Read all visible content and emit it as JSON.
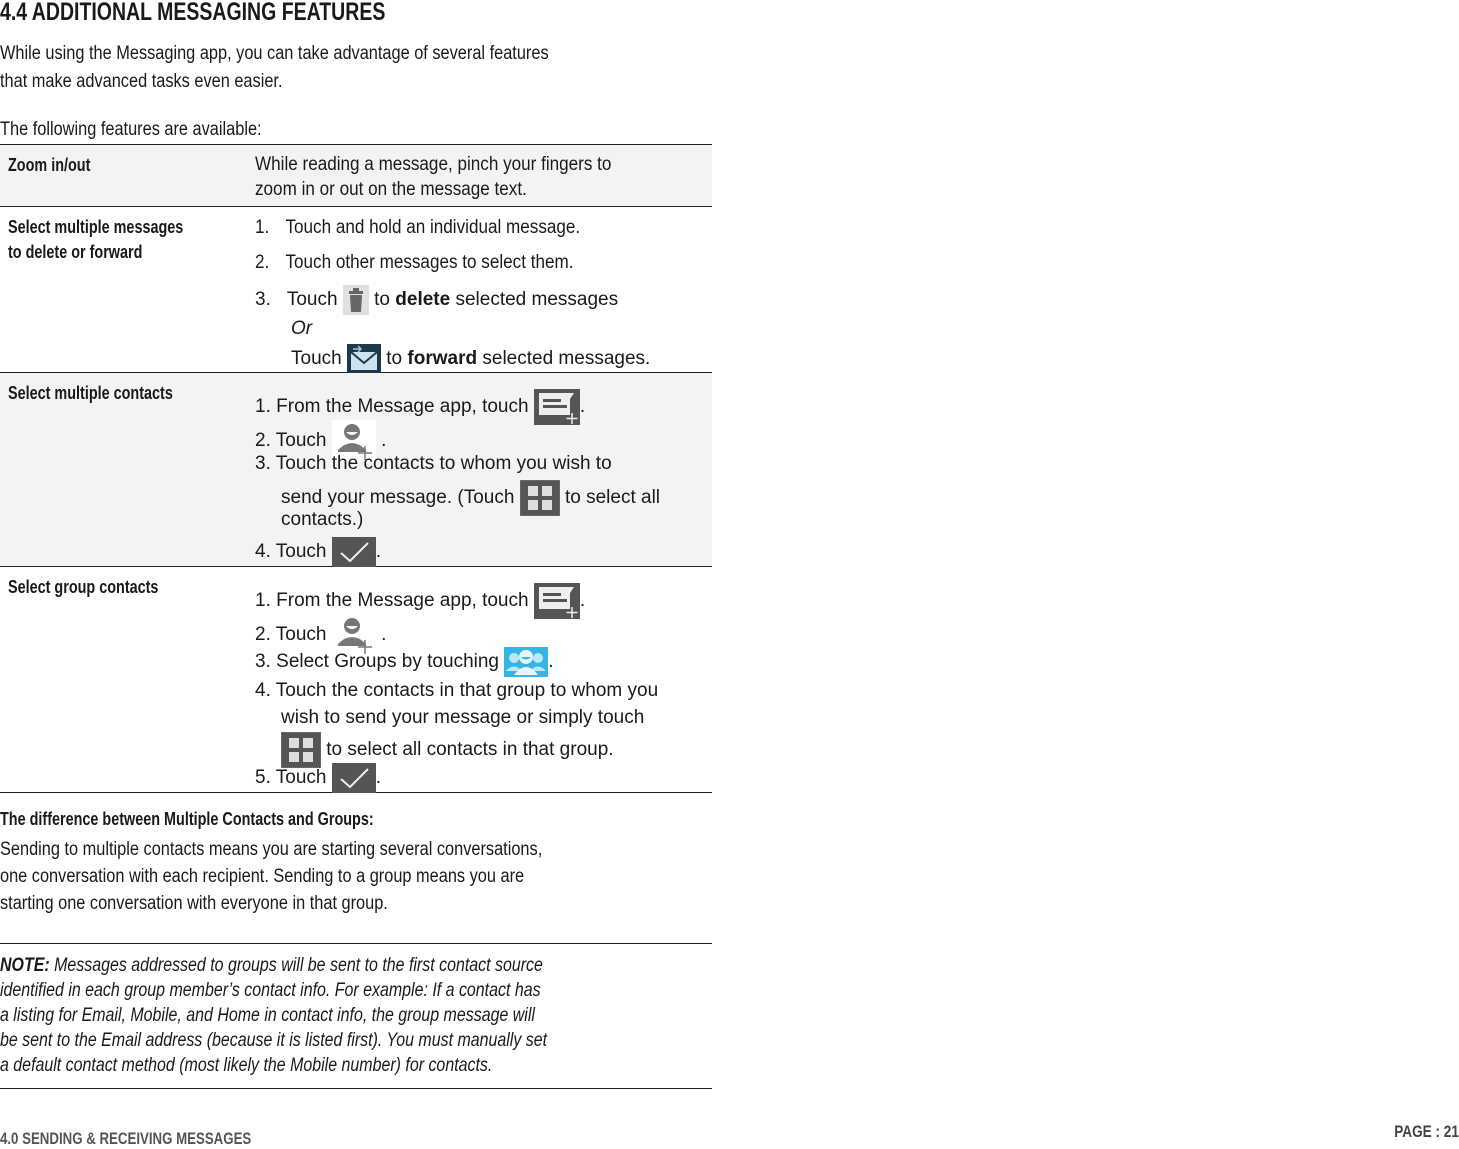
{
  "heading": "4.4 ADDITIONAL MESSAGING FEATURES",
  "intro_lines": [
    "While using the Messaging app, you can take advantage of several features",
    "that make advanced tasks even easier."
  ],
  "available": "The following features are available:",
  "table": {
    "rows": [
      {
        "label": [
          "Zoom in/out"
        ],
        "lines": [
          "While reading a message, pinch your fingers to",
          "zoom in or out on the message text."
        ]
      },
      {
        "label": [
          "Select multiple messages",
          "to delete or forward"
        ],
        "steps": [
          {
            "num": "1.",
            "text": "Touch and hold an individual message."
          },
          {
            "num": "2.",
            "text": "Touch other messages to select them."
          },
          {
            "num": "3.",
            "pre": "Touch",
            "icon": "trash-icon",
            "mid": "to",
            "bold": "delete",
            "post": "selected messages"
          },
          {
            "or": "Or"
          },
          {
            "pre": "Touch",
            "icon": "forward-mail-icon",
            "mid": "to",
            "bold": "forward",
            "post": "selected messages."
          }
        ]
      },
      {
        "label": [
          "Select multiple contacts"
        ],
        "steps": [
          {
            "num": "1.",
            "pre": "From the Message app, touch",
            "icon": "new-message-icon",
            "post": "."
          },
          {
            "num": "2.",
            "pre": "Touch",
            "icon": "add-contact-icon",
            "post": "."
          },
          {
            "num": "3.",
            "text": "Touch the contacts to whom you wish to"
          },
          {
            "pre": "send your message. (Touch",
            "icon": "select-all-icon",
            "post": "to select all"
          },
          {
            "text": "contacts.)"
          },
          {
            "num": "4.",
            "pre": "Touch",
            "icon": "checkmark-icon",
            "post": "."
          }
        ]
      },
      {
        "label": [
          "Select group contacts"
        ],
        "steps": [
          {
            "num": "1.",
            "pre": "From the Message app, touch",
            "icon": "new-message-icon",
            "post": "."
          },
          {
            "num": "2.",
            "pre": "Touch",
            "icon": "add-contact-icon",
            "post": "."
          },
          {
            "num": "3.",
            "pre": "Select Groups by touching",
            "icon": "groups-icon",
            "post": "."
          },
          {
            "num": "4.",
            "text": "Touch the contacts in that group to whom you"
          },
          {
            "text": "wish to send your message or simply touch"
          },
          {
            "icon": "select-all-icon",
            "post": "to select all contacts in that group."
          },
          {
            "num": "5.",
            "pre": "Touch",
            "icon": "checkmark-icon",
            "post": "."
          }
        ]
      }
    ]
  },
  "difference": {
    "title": "The difference between Multiple Contacts and Groups:",
    "lines": [
      "Sending to multiple contacts means you are starting several conversations,",
      "one conversation with each recipient. Sending to a group means you are",
      "starting one conversation with everyone in that group."
    ]
  },
  "note": {
    "label": "NOTE:",
    "lines": [
      "Messages addressed to groups will be sent to the first contact source",
      "identified in each group member’s contact info. For example: If a contact has",
      "a listing for Email, Mobile, and Home in contact info, the group message will",
      "be sent to the Email address (because it is listed first). You must manually set",
      "a default contact method (most likely the Mobile number) for contacts."
    ]
  },
  "footer": {
    "section": "4.0 SENDING & RECEIVING MESSAGES",
    "page": "PAGE : 21"
  },
  "colors": {
    "icon_dark": "#555555",
    "groups_blue": "#33b5e5",
    "forward_navy": "#1c3a4a",
    "row_shade": "#f3f3f3"
  }
}
